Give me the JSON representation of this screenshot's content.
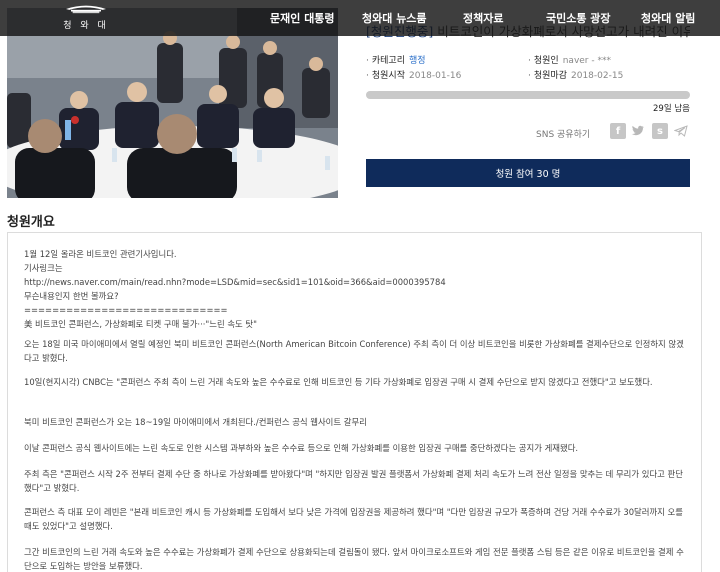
{
  "header": {
    "logo_text": "청 와 대",
    "nav": [
      "문재인 대통령",
      "청와대 뉴스룸",
      "정책자료",
      "국민소통 광장",
      "청와대 알림"
    ]
  },
  "hero": {
    "image_name": "summit-meeting-photo"
  },
  "petition": {
    "status": "[청원진행중]",
    "title": " 비트코인이 가상화폐로서 사망선고가 내려진 이유",
    "category_label": "카테고리",
    "category_value": "행정",
    "petitioner_label": "청원인",
    "petitioner_value": "naver - ***",
    "start_label": "청원시작",
    "start_value": "2018-01-16",
    "end_label": "청원마감",
    "end_value": "2018-02-15",
    "progress_fraction": 0.0,
    "days_left": "29일 남음",
    "sns_label": "SNS 공유하기",
    "sns_icons": [
      "facebook-icon",
      "twitter-icon",
      "kakaostory-icon",
      "telegram-icon"
    ],
    "join_button": "청원 참여 30 명",
    "accent_color": "#0f2b5b"
  },
  "overview": {
    "title": "청원개요",
    "paragraphs": [
      "1월 12일 올라온 비트코인 관련기사입니다.\n기사링크는\nhttp://news.naver.com/main/read.nhn?mode=LSD&mid=sec&sid1=101&oid=366&aid=0000395784\n무슨내용인지 한번 볼까요?\n=============================\n美 비트코인 콘퍼런스, 가상화폐로 티켓 구매 불가···\"느린 속도 탓\"",
      "오는 18일 미국 마이애미에서 열릴 예정인 북미 비트코인 콘퍼런스(North American Bitcoin Conference) 주최 측이 더 이상 비트코인을 비롯한 가상화폐를 결제수단으로 인정하지 않겠다고 밝혔다.",
      "10일(현지시각) CNBC는 \"콘퍼런스 주최 측이 느린 거래 속도와 높은 수수료로 인해 비트코인 등 기타 가상화폐로 입장권 구매 시 결제 수단으로 받지 않겠다고 전했다\"고 보도했다.",
      "북미 비트코인 콘퍼런스가 오는 18~19일 마이애미에서 개최된다./컨퍼런스 공식 웹사이트 갈무리",
      "이날 콘퍼런스 공식 웹사이트에는 느린 속도로 인한 시스템 과부하와 높은 수수료 등으로 인해 가상화폐를 이용한 입장권 구매를 중단하겠다는 공지가 게재됐다.",
      "주최 측은 \"콘퍼런스 시작 2주 전부터 결제 수단 중 하나로 가상화폐를 받아왔다\"며 \"하지만 입장권 발권 플랫폼서 가상화폐 결제 처리 속도가 느려 전산 일정을 맞추는 데 무리가 있다고 판단했다\"고 밝혔다.",
      "콘퍼런스 측 대표 모이 레빈은 \"본래 비트코인 캐시 등 가상화폐를 도입해서 보다 낮은 가격에 입장권을 제공하려 했다\"며 \"다만 입장권 규모가 폭증하며 건당 거래 수수료가 30달러까지 오를 때도 있었다\"고 설명했다.",
      "그간 비트코인의 느린 거래 속도와 높은 수수료는 가상화폐가 결제 수단으로 상용화되는데 걸림돌이 됐다. 앞서 마이크로소프트와 게임 전문 플랫폼 스팀 등은 같은 이유로 비트코인을 결제 수단으로 도입하는 방안을 보류했다."
    ]
  }
}
